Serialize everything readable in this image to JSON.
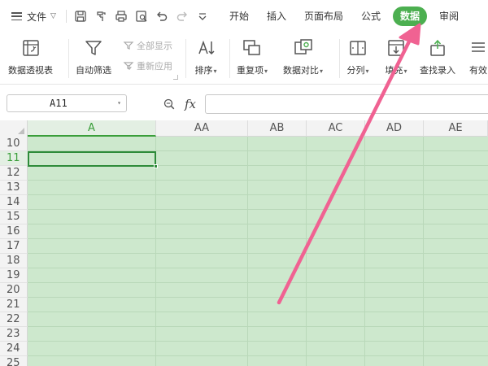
{
  "app": {
    "menu_label": "文件"
  },
  "quick_access": [
    {
      "name": "save-icon"
    },
    {
      "name": "format-painter-icon"
    },
    {
      "name": "print-icon"
    },
    {
      "name": "print-preview-icon"
    },
    {
      "name": "undo-icon"
    },
    {
      "name": "redo-icon"
    },
    {
      "name": "customize-qat-icon"
    }
  ],
  "tabs": [
    {
      "label": "开始",
      "active": false
    },
    {
      "label": "插入",
      "active": false
    },
    {
      "label": "页面布局",
      "active": false
    },
    {
      "label": "公式",
      "active": false
    },
    {
      "label": "数据",
      "active": true
    },
    {
      "label": "审阅",
      "active": false
    }
  ],
  "ribbon": {
    "pivot_table": "数据透视表",
    "auto_filter": "自动筛选",
    "show_all": "全部显示",
    "reapply": "重新应用",
    "sort": "排序",
    "duplicates": "重复项",
    "compare": "数据对比",
    "split_column": "分列",
    "fill": "填充",
    "lookup_entry": "查找录入",
    "validity": "有效"
  },
  "formula_bar": {
    "name_box": "A11",
    "fx_label": "fx",
    "formula_value": ""
  },
  "grid": {
    "columns": [
      "A",
      "AA",
      "AB",
      "AC",
      "AD",
      "AE"
    ],
    "selected_column": "A",
    "rows": [
      "10",
      "11",
      "12",
      "13",
      "14",
      "15",
      "16",
      "17",
      "18",
      "19",
      "20",
      "21",
      "22",
      "23",
      "24",
      "25"
    ],
    "selected_row": "11",
    "active_cell": "A11"
  },
  "colors": {
    "accent": "#4caf50",
    "selection": "#2e8b3a",
    "sheet_background": "#cde8cd",
    "arrow": "#f06292"
  }
}
